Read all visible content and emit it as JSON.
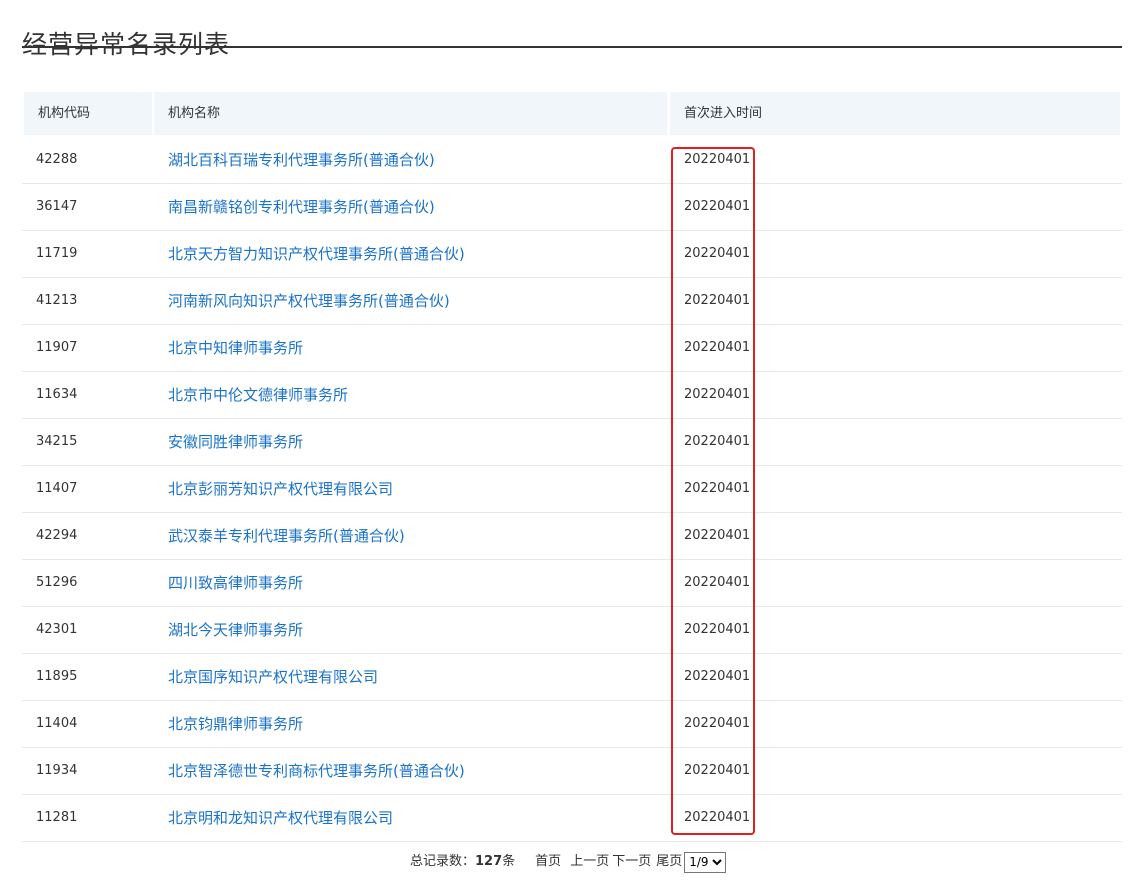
{
  "page": {
    "title": "经营异常名录列表"
  },
  "table": {
    "headers": [
      "机构代码",
      "机构名称",
      "首次进入时间"
    ],
    "rows": [
      {
        "code": "42288",
        "name": "湖北百科百瑞专利代理事务所(普通合伙)",
        "date": "20220401"
      },
      {
        "code": "36147",
        "name": "南昌新赣铭创专利代理事务所(普通合伙)",
        "date": "20220401"
      },
      {
        "code": "11719",
        "name": "北京天方智力知识产权代理事务所(普通合伙)",
        "date": "20220401"
      },
      {
        "code": "41213",
        "name": "河南新风向知识产权代理事务所(普通合伙)",
        "date": "20220401"
      },
      {
        "code": "11907",
        "name": "北京中知律师事务所",
        "date": "20220401"
      },
      {
        "code": "11634",
        "name": "北京市中伦文德律师事务所",
        "date": "20220401"
      },
      {
        "code": "34215",
        "name": "安徽同胜律师事务所",
        "date": "20220401"
      },
      {
        "code": "11407",
        "name": "北京彭丽芳知识产权代理有限公司",
        "date": "20220401"
      },
      {
        "code": "42294",
        "name": "武汉泰羊专利代理事务所(普通合伙)",
        "date": "20220401"
      },
      {
        "code": "51296",
        "name": "四川致高律师事务所",
        "date": "20220401"
      },
      {
        "code": "42301",
        "name": "湖北今天律师事务所",
        "date": "20220401"
      },
      {
        "code": "11895",
        "name": "北京国序知识产权代理有限公司",
        "date": "20220401"
      },
      {
        "code": "11404",
        "name": "北京钧鼎律师事务所",
        "date": "20220401"
      },
      {
        "code": "11934",
        "name": "北京智泽德世专利商标代理事务所(普通合伙)",
        "date": "20220401"
      },
      {
        "code": "11281",
        "name": "北京明和龙知识产权代理有限公司",
        "date": "20220401"
      }
    ]
  },
  "pager": {
    "total_label": "总记录数：",
    "total_count": "127",
    "total_unit": "条",
    "first": "首页",
    "prev": "上一页",
    "next": "下一页",
    "last": "尾页",
    "page_select": "1/9"
  },
  "colors": {
    "link": "#1a73c9",
    "header_bg": "#f1f6fb",
    "highlight": "#e02020"
  }
}
